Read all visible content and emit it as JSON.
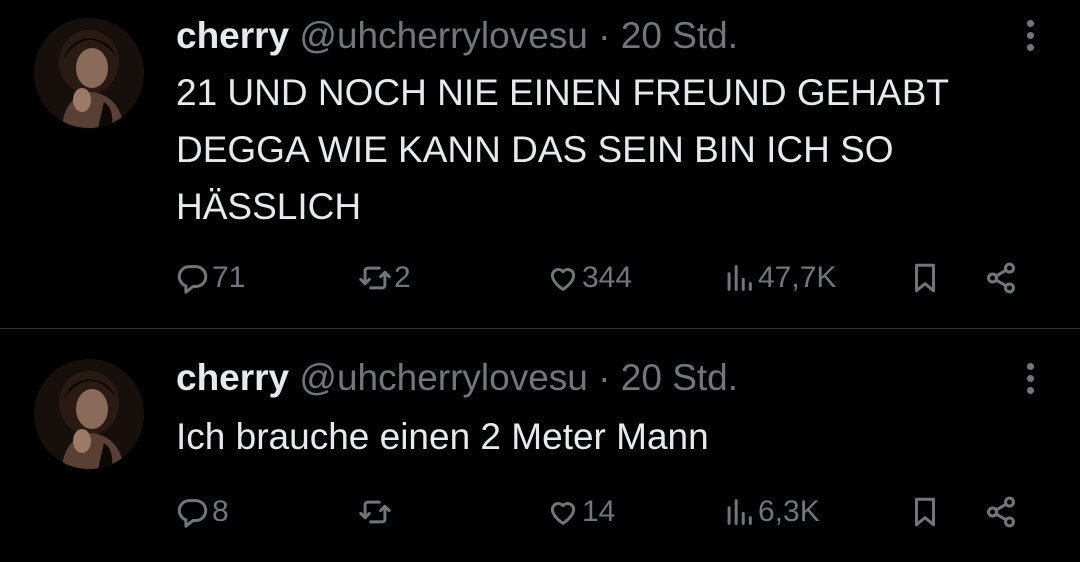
{
  "tweets": [
    {
      "name": "cherry",
      "handle": "@uhcherrylovesu",
      "separator": "·",
      "time": "20 Std.",
      "text": "21 UND NOCH NIE EINEN FREUND GEHABT DEGGA WIE KANN DAS SEIN BIN ICH SO HÄSSLICH",
      "replies": "71",
      "retweets": "2",
      "likes": "344",
      "views": "47,7K"
    },
    {
      "name": "cherry",
      "handle": "@uhcherrylovesu",
      "separator": "·",
      "time": "20 Std.",
      "text": "Ich brauche einen 2 Meter Mann",
      "replies": "8",
      "retweets": "",
      "likes": "14",
      "views": "6,3K"
    }
  ],
  "icons": {
    "reply": "reply-icon",
    "retweet": "retweet-icon",
    "like": "heart-icon",
    "views": "views-icon",
    "bookmark": "bookmark-icon",
    "share": "share-icon",
    "more": "more-icon"
  },
  "colors": {
    "background": "#000000",
    "text": "#e7e9ea",
    "muted": "#71767b",
    "divider": "#2f3336"
  }
}
